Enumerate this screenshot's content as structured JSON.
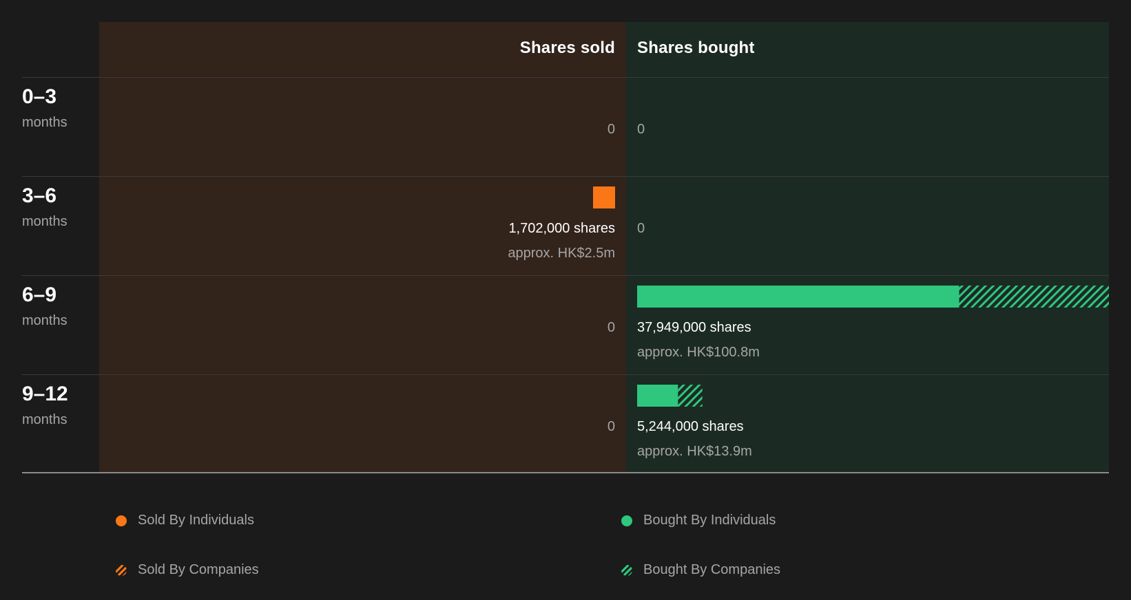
{
  "colors": {
    "sold": "#f97716",
    "bought": "#2ec77d",
    "muted": "#a6a6a6"
  },
  "headers": {
    "sold": "Shares sold",
    "bought": "Shares bought"
  },
  "rows": [
    {
      "range": "0–3",
      "unit": "months",
      "sold_zero": "0",
      "bought_zero": "0"
    },
    {
      "range": "3–6",
      "unit": "months",
      "sold_amount": "1,702,000 shares",
      "sold_approx": "approx. HK$2.5m",
      "bought_zero": "0"
    },
    {
      "range": "6–9",
      "unit": "months",
      "sold_zero": "0",
      "bought_amount": "37,949,000 shares",
      "bought_approx": "approx. HK$100.8m"
    },
    {
      "range": "9–12",
      "unit": "months",
      "sold_zero": "0",
      "bought_amount": "5,244,000 shares",
      "bought_approx": "approx. HK$13.9m"
    }
  ],
  "legend": {
    "sold_individuals": "Sold By Individuals",
    "sold_companies": "Sold By Companies",
    "bought_individuals": "Bought By Individuals",
    "bought_companies": "Bought By Companies"
  },
  "chart_data": {
    "type": "bar",
    "categories": [
      "0–3 months",
      "3–6 months",
      "6–9 months",
      "9–12 months"
    ],
    "series": [
      {
        "name": "Sold By Individuals",
        "values": [
          0,
          1702000,
          0,
          0
        ]
      },
      {
        "name": "Sold By Companies",
        "values": [
          0,
          0,
          0,
          0
        ]
      },
      {
        "name": "Bought By Individuals",
        "values": [
          0,
          0,
          25900000,
          3290000
        ]
      },
      {
        "name": "Bought By Companies",
        "values": [
          0,
          0,
          12049000,
          1954000
        ]
      }
    ],
    "scale_max": 37949000
  }
}
